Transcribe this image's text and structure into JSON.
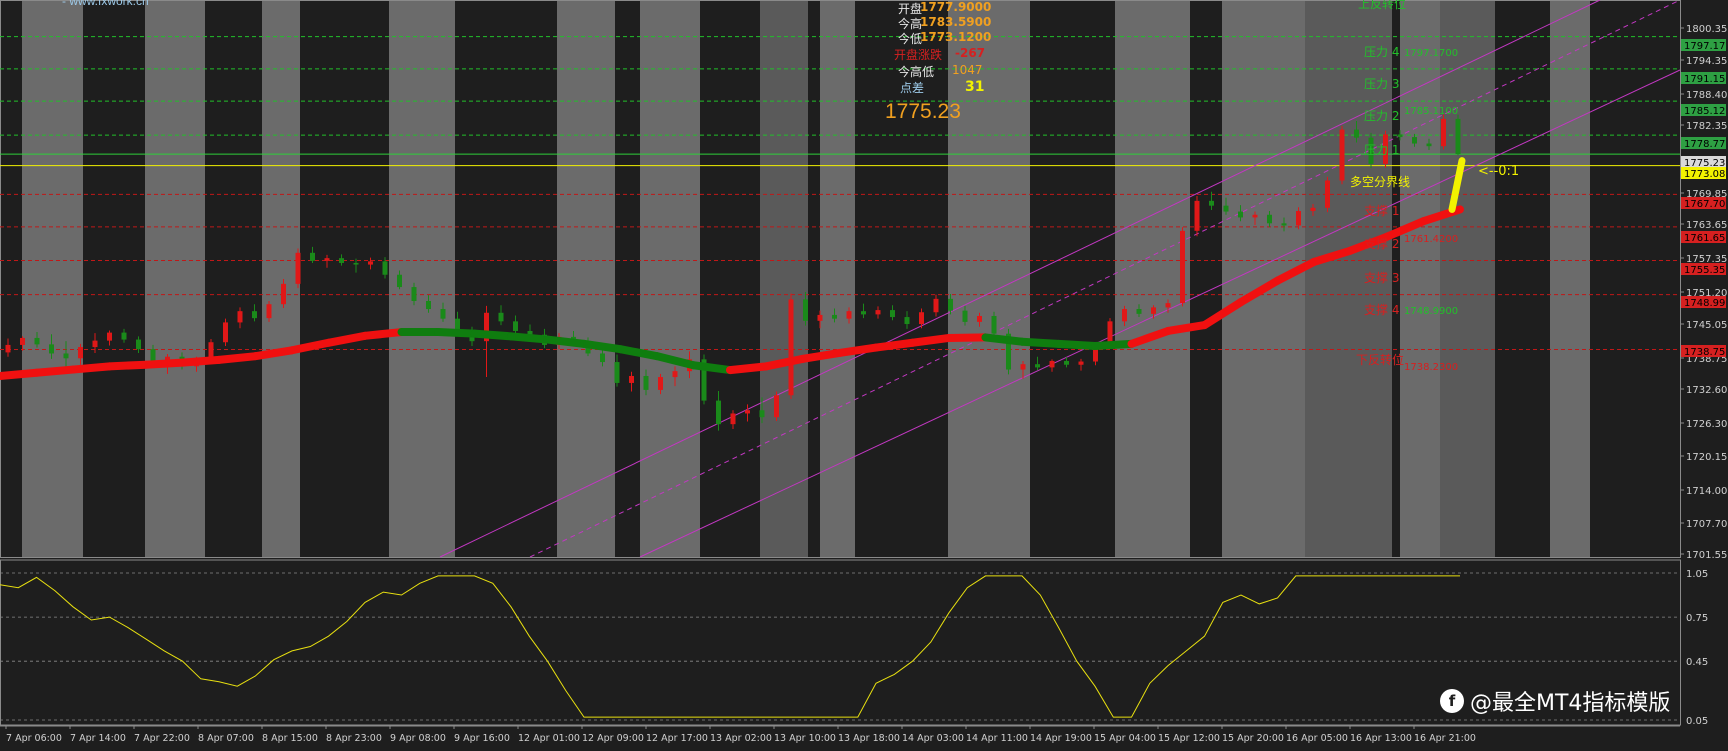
{
  "header_note": "- www.fxwork.cn",
  "info_panel": {
    "open_label": "开盘",
    "open_value": "1777.9000",
    "high_label": "今高",
    "high_value": "1783.5900",
    "low_label": "今低",
    "low_value": "1773.1200",
    "change_label": "开盘涨跌",
    "change_value": "-267",
    "range_label": "今高低",
    "range_value": "1047",
    "spread_label": "点差",
    "spread_value": "31",
    "current_price": "1775.23"
  },
  "levels": {
    "upper_reversal": "上反转位",
    "resistance_4": "压力 4",
    "resistance_4_value": "1797.1700",
    "resistance_3": "压力 3",
    "resistance_2": "压力 2",
    "resistance_2_value": "1785.1100",
    "resistance_1": "压力 1",
    "bull_bear_line": "多空分界线",
    "ratio_marker": "<--0:1",
    "support_1": "支撑 1",
    "support_2": "支撑 2",
    "support_2_value": "1761.4200",
    "support_3": "支撑 3",
    "support_4": "支撑 4",
    "support_4_value": "1748.9900",
    "lower_reversal": "下反转位",
    "lower_reversal_value": "1738.2300"
  },
  "price_axis": {
    "ticks": [
      "1800.35",
      "1794.35",
      "1788.40",
      "1782.35",
      "1769.85",
      "1763.65",
      "1757.35",
      "1751.20",
      "1745.05",
      "1738.75",
      "1732.60",
      "1726.30",
      "1720.15",
      "1714.00",
      "1707.70",
      "1701.55"
    ],
    "tags": [
      {
        "label": "1797.17",
        "color": "#2ea043"
      },
      {
        "label": "1791.15",
        "color": "#2ea043"
      },
      {
        "label": "1785.12",
        "color": "#2ea043"
      },
      {
        "label": "1778.77",
        "color": "#2ea043"
      },
      {
        "label": "1775.23",
        "color": "#d9d9d9"
      },
      {
        "label": "1773.08",
        "color": "#f2f200"
      },
      {
        "label": "1767.70",
        "color": "#d62020"
      },
      {
        "label": "1761.65",
        "color": "#d62020"
      },
      {
        "label": "1755.35",
        "color": "#d62020"
      },
      {
        "label": "1748.99",
        "color": "#d62020"
      },
      {
        "label": "1738.75",
        "color": "#d62020"
      }
    ]
  },
  "osc_axis": {
    "ticks": [
      "1.05",
      "0.75",
      "0.45",
      "0.05"
    ]
  },
  "time_axis": {
    "labels": [
      "7 Apr 06:00",
      "7 Apr 14:00",
      "7 Apr 22:00",
      "8 Apr 07:00",
      "8 Apr 15:00",
      "8 Apr 23:00",
      "9 Apr 08:00",
      "9 Apr 16:00",
      "12 Apr 01:00",
      "12 Apr 09:00",
      "12 Apr 17:00",
      "13 Apr 02:00",
      "13 Apr 10:00",
      "13 Apr 18:00",
      "14 Apr 03:00",
      "14 Apr 11:00",
      "14 Apr 19:00",
      "15 Apr 04:00",
      "15 Apr 12:00",
      "15 Apr 20:00",
      "16 Apr 05:00",
      "16 Apr 13:00",
      "16 Apr 21:00"
    ]
  },
  "watermark": "@最全MT4指标模版",
  "watermark_icon": "toutiao-logo-icon",
  "chart_data": {
    "type": "candlestick",
    "symbol_price": 1775.23,
    "y_range": [
      1700,
      1804
    ],
    "oscillator_range": [
      0.05,
      1.05
    ],
    "levels": {
      "upper_resistances": [
        1797.17,
        1791.15,
        1785.12,
        1778.77
      ],
      "current": 1775.23,
      "bull_bear": 1773.08,
      "supports": [
        1767.7,
        1761.65,
        1755.35,
        1748.99,
        1738.75
      ]
    },
    "candles_ohlc": [
      [
        1738.2,
        1740.8,
        1737.4,
        1739.6
      ],
      [
        1739.6,
        1741.2,
        1738.5,
        1740.9
      ],
      [
        1740.9,
        1742.0,
        1739.1,
        1739.7
      ],
      [
        1739.7,
        1741.6,
        1737.0,
        1738.0
      ],
      [
        1738.0,
        1740.3,
        1735.2,
        1737.1
      ],
      [
        1737.1,
        1739.8,
        1735.9,
        1739.2
      ],
      [
        1739.2,
        1741.8,
        1738.1,
        1740.4
      ],
      [
        1740.4,
        1742.3,
        1739.5,
        1741.9
      ],
      [
        1741.9,
        1742.6,
        1740.0,
        1740.6
      ],
      [
        1740.6,
        1741.2,
        1738.1,
        1738.8
      ],
      [
        1738.8,
        1739.6,
        1735.4,
        1736.1
      ],
      [
        1736.1,
        1737.9,
        1734.2,
        1737.4
      ],
      [
        1737.4,
        1738.2,
        1735.0,
        1735.6
      ],
      [
        1735.6,
        1737.4,
        1734.6,
        1736.9
      ],
      [
        1736.9,
        1740.7,
        1736.2,
        1740.1
      ],
      [
        1740.1,
        1744.5,
        1739.4,
        1743.8
      ],
      [
        1743.8,
        1746.6,
        1742.7,
        1745.9
      ],
      [
        1745.9,
        1747.2,
        1744.0,
        1744.6
      ],
      [
        1744.6,
        1747.8,
        1743.9,
        1747.2
      ],
      [
        1747.2,
        1751.9,
        1746.5,
        1751.0
      ],
      [
        1751.0,
        1757.6,
        1750.2,
        1756.8
      ],
      [
        1756.8,
        1757.9,
        1754.9,
        1755.3
      ],
      [
        1755.3,
        1756.4,
        1754.0,
        1755.8
      ],
      [
        1755.8,
        1756.5,
        1754.4,
        1754.9
      ],
      [
        1754.9,
        1755.7,
        1753.1,
        1754.6
      ],
      [
        1754.6,
        1755.9,
        1753.7,
        1755.2
      ],
      [
        1755.2,
        1756.0,
        1752.0,
        1752.7
      ],
      [
        1752.7,
        1753.5,
        1750.0,
        1750.4
      ],
      [
        1750.4,
        1751.2,
        1747.0,
        1747.8
      ],
      [
        1747.8,
        1748.9,
        1745.6,
        1746.3
      ],
      [
        1746.3,
        1747.5,
        1743.9,
        1744.5
      ],
      [
        1744.5,
        1745.8,
        1741.2,
        1741.9
      ],
      [
        1741.9,
        1743.0,
        1739.4,
        1740.3
      ],
      [
        1740.3,
        1746.9,
        1733.6,
        1745.6
      ],
      [
        1745.6,
        1747.0,
        1743.3,
        1744.0
      ],
      [
        1744.0,
        1745.1,
        1741.7,
        1742.2
      ],
      [
        1742.2,
        1743.4,
        1740.3,
        1741.5
      ],
      [
        1741.5,
        1742.6,
        1739.0,
        1739.6
      ],
      [
        1739.6,
        1741.8,
        1738.8,
        1741.1
      ],
      [
        1741.1,
        1742.2,
        1739.7,
        1740.2
      ],
      [
        1740.2,
        1741.0,
        1737.5,
        1738.0
      ],
      [
        1738.0,
        1739.3,
        1735.6,
        1736.4
      ],
      [
        1736.4,
        1737.8,
        1731.8,
        1732.5
      ],
      [
        1732.5,
        1734.6,
        1730.9,
        1733.8
      ],
      [
        1733.8,
        1735.0,
        1730.2,
        1731.2
      ],
      [
        1731.2,
        1734.2,
        1730.4,
        1733.6
      ],
      [
        1733.6,
        1735.6,
        1731.9,
        1734.7
      ],
      [
        1734.7,
        1738.4,
        1733.4,
        1736.9
      ],
      [
        1736.9,
        1737.8,
        1728.5,
        1729.2
      ],
      [
        1729.2,
        1731.0,
        1723.6,
        1724.8
      ],
      [
        1724.8,
        1727.4,
        1723.9,
        1726.8
      ],
      [
        1726.8,
        1728.5,
        1725.3,
        1727.4
      ],
      [
        1727.4,
        1729.8,
        1725.0,
        1726.1
      ],
      [
        1726.1,
        1730.9,
        1725.4,
        1730.2
      ],
      [
        1730.2,
        1749.2,
        1729.5,
        1748.1
      ],
      [
        1748.1,
        1749.5,
        1743.2,
        1744.1
      ],
      [
        1744.1,
        1746.0,
        1742.7,
        1745.2
      ],
      [
        1745.2,
        1746.4,
        1743.8,
        1744.5
      ],
      [
        1744.5,
        1746.6,
        1743.6,
        1745.9
      ],
      [
        1745.9,
        1747.3,
        1744.6,
        1745.3
      ],
      [
        1745.3,
        1746.8,
        1744.5,
        1746.1
      ],
      [
        1746.1,
        1747.0,
        1744.2,
        1744.8
      ],
      [
        1744.8,
        1745.9,
        1742.6,
        1743.5
      ],
      [
        1743.5,
        1746.4,
        1742.7,
        1745.7
      ],
      [
        1745.7,
        1749.0,
        1744.9,
        1748.2
      ],
      [
        1748.2,
        1749.1,
        1745.3,
        1746.0
      ],
      [
        1746.0,
        1746.9,
        1743.2,
        1743.9
      ],
      [
        1743.9,
        1745.6,
        1743.0,
        1745.0
      ],
      [
        1745.0,
        1745.8,
        1741.0,
        1741.7
      ],
      [
        1741.7,
        1742.6,
        1734.1,
        1735.0
      ],
      [
        1735.0,
        1736.6,
        1733.3,
        1736.0
      ],
      [
        1736.0,
        1737.4,
        1734.9,
        1735.4
      ],
      [
        1735.4,
        1736.9,
        1734.6,
        1736.6
      ],
      [
        1736.6,
        1737.3,
        1735.4,
        1735.9
      ],
      [
        1735.9,
        1737.0,
        1734.8,
        1736.5
      ],
      [
        1736.5,
        1740.1,
        1735.8,
        1739.6
      ],
      [
        1739.6,
        1744.6,
        1739.0,
        1744.0
      ],
      [
        1744.0,
        1746.9,
        1743.1,
        1746.3
      ],
      [
        1746.3,
        1747.2,
        1744.8,
        1745.4
      ],
      [
        1745.4,
        1747.0,
        1744.5,
        1746.6
      ],
      [
        1746.6,
        1748.1,
        1745.6,
        1747.4
      ],
      [
        1747.4,
        1761.6,
        1746.8,
        1760.9
      ],
      [
        1760.9,
        1767.4,
        1759.9,
        1766.5
      ],
      [
        1766.5,
        1768.2,
        1764.8,
        1765.6
      ],
      [
        1765.6,
        1767.1,
        1763.9,
        1764.5
      ],
      [
        1764.5,
        1765.7,
        1762.7,
        1763.4
      ],
      [
        1763.4,
        1764.5,
        1762.0,
        1763.9
      ],
      [
        1763.9,
        1764.6,
        1761.6,
        1762.3
      ],
      [
        1762.3,
        1763.4,
        1760.8,
        1761.9
      ],
      [
        1761.9,
        1765.3,
        1761.2,
        1764.6
      ],
      [
        1764.6,
        1765.9,
        1763.7,
        1765.2
      ],
      [
        1765.2,
        1771.0,
        1764.4,
        1770.3
      ],
      [
        1770.3,
        1780.5,
        1769.6,
        1779.8
      ],
      [
        1779.8,
        1781.4,
        1777.4,
        1778.3
      ],
      [
        1778.3,
        1779.2,
        1772.6,
        1773.4
      ],
      [
        1773.4,
        1779.6,
        1772.7,
        1778.9
      ],
      [
        1778.9,
        1779.7,
        1777.8,
        1778.4
      ],
      [
        1778.4,
        1779.0,
        1776.6,
        1777.2
      ],
      [
        1777.2,
        1778.1,
        1776.0,
        1776.7
      ],
      [
        1776.7,
        1782.6,
        1776.1,
        1781.8
      ],
      [
        1781.8,
        1782.6,
        1775.0,
        1775.23
      ]
    ],
    "moving_average": [
      1733.8,
      1734.4,
      1735.0,
      1735.6,
      1735.9,
      1736.3,
      1736.8,
      1737.5,
      1738.6,
      1740.0,
      1741.3,
      1742.0,
      1742.0,
      1741.7,
      1741.2,
      1740.6,
      1739.8,
      1738.8,
      1737.5,
      1735.8,
      1734.9,
      1735.6,
      1737.0,
      1738.1,
      1739.1,
      1740.0,
      1740.9,
      1741.0,
      1740.2,
      1739.8,
      1739.4,
      1739.8,
      1742.2,
      1743.3,
      1747.6,
      1751.6,
      1755.1,
      1757.2,
      1759.8,
      1762.7,
      1764.9
    ],
    "ma_trend_colors": [
      "up",
      "up",
      "up",
      "up",
      "up",
      "up",
      "up",
      "up",
      "up",
      "up",
      "up",
      "down",
      "down",
      "down",
      "down",
      "down",
      "down",
      "down",
      "down",
      "down",
      "up",
      "up",
      "up",
      "up",
      "up",
      "up",
      "up",
      "down",
      "down",
      "down",
      "down",
      "up",
      "up",
      "up",
      "up",
      "up",
      "up",
      "up",
      "up",
      "up",
      "up"
    ],
    "oscillator": [
      0.97,
      0.95,
      1.02,
      0.93,
      0.82,
      0.73,
      0.75,
      0.68,
      0.6,
      0.52,
      0.45,
      0.33,
      0.31,
      0.28,
      0.35,
      0.46,
      0.52,
      0.55,
      0.62,
      0.72,
      0.85,
      0.92,
      0.9,
      0.98,
      1.03,
      1.03,
      1.03,
      0.98,
      0.82,
      0.62,
      0.45,
      0.25,
      0.07,
      0.07,
      0.07,
      0.07,
      0.07,
      0.07,
      0.07,
      0.07,
      0.07,
      0.07,
      0.07,
      0.07,
      0.07,
      0.07,
      0.07,
      0.07,
      0.3,
      0.36,
      0.45,
      0.58,
      0.78,
      0.95,
      1.03,
      1.03,
      1.03,
      0.9,
      0.68,
      0.45,
      0.28,
      0.07,
      0.07,
      0.3,
      0.42,
      0.52,
      0.62,
      0.85,
      0.9,
      0.84,
      0.88,
      1.03,
      1.03,
      1.03,
      1.03,
      1.03,
      1.03,
      1.03,
      1.03,
      1.03,
      1.03
    ]
  }
}
